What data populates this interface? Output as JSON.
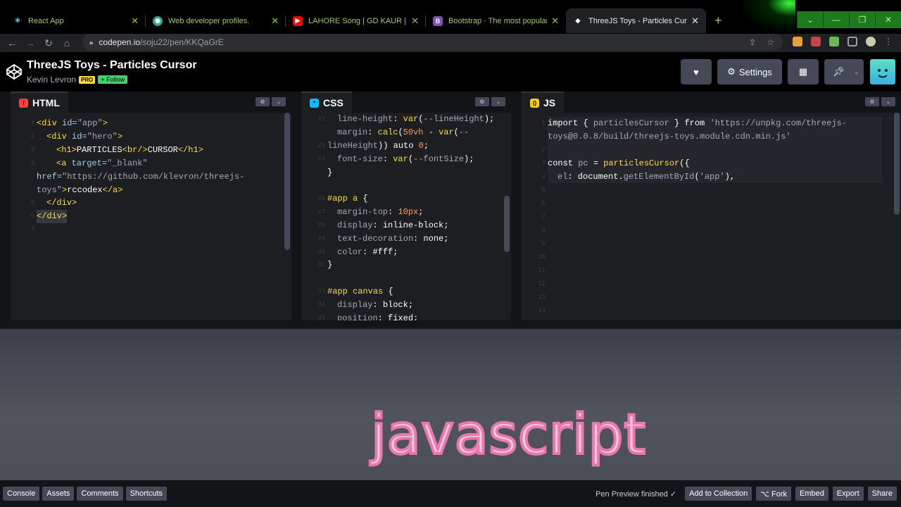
{
  "browser": {
    "tabs": [
      {
        "label": "React App",
        "color": "#61dafb",
        "glyph": "⚛"
      },
      {
        "label": "Web developer profiles.",
        "color": "#2ea58f",
        "glyph": "◉"
      },
      {
        "label": "LAHORE Song | GD KAUR | Nand",
        "color": "#ff0000",
        "glyph": "▶"
      },
      {
        "label": "Bootstrap · The most popular HT",
        "color": "#7952b3",
        "glyph": "B"
      },
      {
        "label": "ThreeJS Toys - Particles Cursor",
        "color": "#ffffff",
        "glyph": "◆"
      }
    ],
    "url_host": "codepen.io",
    "url_path": "/soju22/pen/KKQaGrE"
  },
  "codepen": {
    "title": "ThreeJS Toys - Particles Cursor",
    "author": "Kevin Levron",
    "pro_badge": "PRO",
    "follow_label": "+ Follow",
    "settings_label": "Settings"
  },
  "panels": {
    "html_label": "HTML",
    "css_label": "CSS",
    "js_label": "JS"
  },
  "preview": {
    "text": "javascript"
  },
  "footer": {
    "left": [
      "Console",
      "Assets",
      "Comments",
      "Shortcuts"
    ],
    "status": "Pen Preview finished ✓",
    "right": [
      "Add to Collection",
      "⌥ Fork",
      "Embed",
      "Export",
      "Share"
    ]
  },
  "colors": {
    "accent_green": "#47cf73",
    "pro_yellow": "#ffdd40",
    "editor_bg": "#1d1e22"
  }
}
